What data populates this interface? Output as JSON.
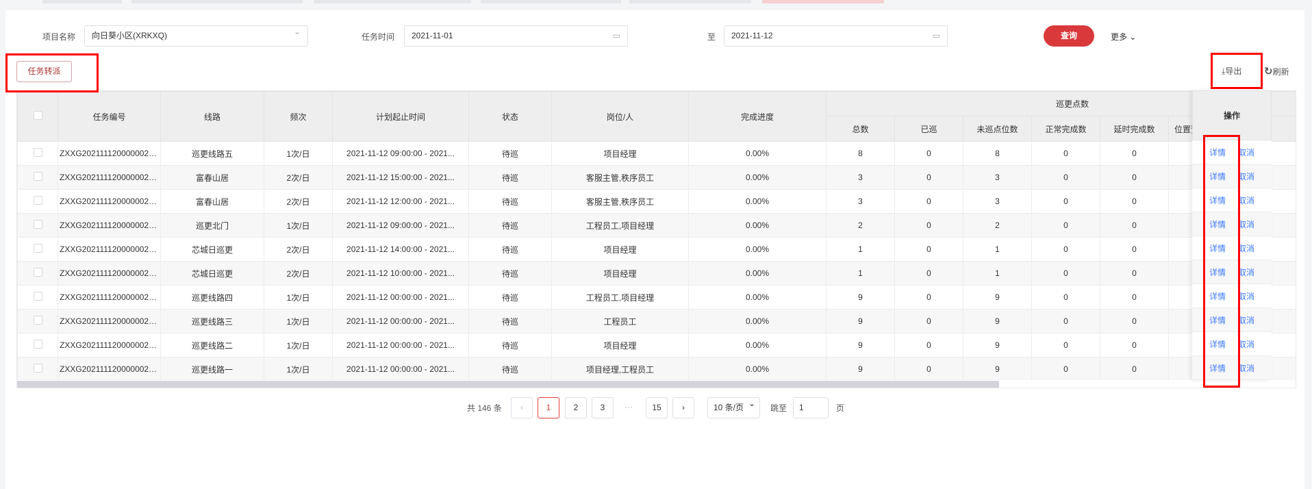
{
  "filters": {
    "project_label": "项目名称",
    "project_value": "向日葵小区(XRKXQ)",
    "time_label": "任务时间",
    "start_date": "2021-11-01",
    "to_label": "至",
    "end_date": "2021-11-12",
    "query_label": "查询",
    "more_label": "更多"
  },
  "toolbar": {
    "transfer_label": "任务转派",
    "export_label": "导出",
    "refresh_label": "刷新"
  },
  "table": {
    "headers": {
      "task_no": "任务编号",
      "route": "线路",
      "freq": "频次",
      "plan_time": "计划起止时间",
      "status": "状态",
      "post": "岗位/人",
      "progress": "完成进度",
      "group": "巡更点数",
      "total": "总数",
      "done": "已巡",
      "undone": "未巡点位数",
      "normal": "正常完成数",
      "delay": "延时完成数",
      "position": "位置预",
      "action": "操作"
    },
    "rows": [
      {
        "task_no": "ZXXG2021111200000028...",
        "route": "巡更线路五",
        "freq": "1次/日",
        "plan_time": "2021-11-12 09:00:00 - 2021...",
        "status": "待巡",
        "post": "项目经理",
        "progress": "0.00%",
        "total": "8",
        "done": "0",
        "undone": "8",
        "normal": "0",
        "delay": "0"
      },
      {
        "task_no": "ZXXG2021111200000028...",
        "route": "富春山居",
        "freq": "2次/日",
        "plan_time": "2021-11-12 15:00:00 - 2021...",
        "status": "待巡",
        "post": "客服主管,秩序员工",
        "progress": "0.00%",
        "total": "3",
        "done": "0",
        "undone": "3",
        "normal": "0",
        "delay": "0"
      },
      {
        "task_no": "ZXXG2021111200000028...",
        "route": "富春山居",
        "freq": "2次/日",
        "plan_time": "2021-11-12 12:00:00 - 2021...",
        "status": "待巡",
        "post": "客服主管,秩序员工",
        "progress": "0.00%",
        "total": "3",
        "done": "0",
        "undone": "3",
        "normal": "0",
        "delay": "0"
      },
      {
        "task_no": "ZXXG2021111200000028...",
        "route": "巡更北门",
        "freq": "1次/日",
        "plan_time": "2021-11-12 09:00:00 - 2021...",
        "status": "待巡",
        "post": "工程员工,项目经理",
        "progress": "0.00%",
        "total": "2",
        "done": "0",
        "undone": "2",
        "normal": "0",
        "delay": "0"
      },
      {
        "task_no": "ZXXG2021111200000028...",
        "route": "芯城日巡更",
        "freq": "2次/日",
        "plan_time": "2021-11-12 14:00:00 - 2021...",
        "status": "待巡",
        "post": "项目经理",
        "progress": "0.00%",
        "total": "1",
        "done": "0",
        "undone": "1",
        "normal": "0",
        "delay": "0"
      },
      {
        "task_no": "ZXXG2021111200000028...",
        "route": "芯城日巡更",
        "freq": "2次/日",
        "plan_time": "2021-11-12 10:00:00 - 2021...",
        "status": "待巡",
        "post": "项目经理",
        "progress": "0.00%",
        "total": "1",
        "done": "0",
        "undone": "1",
        "normal": "0",
        "delay": "0"
      },
      {
        "task_no": "ZXXG2021111200000028...",
        "route": "巡更线路四",
        "freq": "1次/日",
        "plan_time": "2021-11-12 00:00:00 - 2021...",
        "status": "待巡",
        "post": "工程员工,项目经理",
        "progress": "0.00%",
        "total": "9",
        "done": "0",
        "undone": "9",
        "normal": "0",
        "delay": "0"
      },
      {
        "task_no": "ZXXG2021111200000028...",
        "route": "巡更线路三",
        "freq": "1次/日",
        "plan_time": "2021-11-12 00:00:00 - 2021...",
        "status": "待巡",
        "post": "工程员工",
        "progress": "0.00%",
        "total": "9",
        "done": "0",
        "undone": "9",
        "normal": "0",
        "delay": "0"
      },
      {
        "task_no": "ZXXG2021111200000028...",
        "route": "巡更线路二",
        "freq": "1次/日",
        "plan_time": "2021-11-12 00:00:00 - 2021...",
        "status": "待巡",
        "post": "项目经理",
        "progress": "0.00%",
        "total": "9",
        "done": "0",
        "undone": "9",
        "normal": "0",
        "delay": "0"
      },
      {
        "task_no": "ZXXG2021111200000028...",
        "route": "巡更线路一",
        "freq": "1次/日",
        "plan_time": "2021-11-12 00:00:00 - 2021...",
        "status": "待巡",
        "post": "项目经理,工程员工",
        "progress": "0.00%",
        "total": "9",
        "done": "0",
        "undone": "9",
        "normal": "0",
        "delay": "0"
      }
    ],
    "detail_label": "详情",
    "cancel_label": "取消"
  },
  "pagination": {
    "total_text": "共 146 条",
    "pages": [
      "1",
      "2",
      "3",
      "15"
    ],
    "current": "1",
    "ellipsis": "···",
    "page_size": "10 条/页",
    "jump_label": "跳至",
    "jump_value": "1",
    "page_suffix": "页"
  },
  "colors": {
    "primary": "#d9393b",
    "link": "#3e7bfa"
  }
}
